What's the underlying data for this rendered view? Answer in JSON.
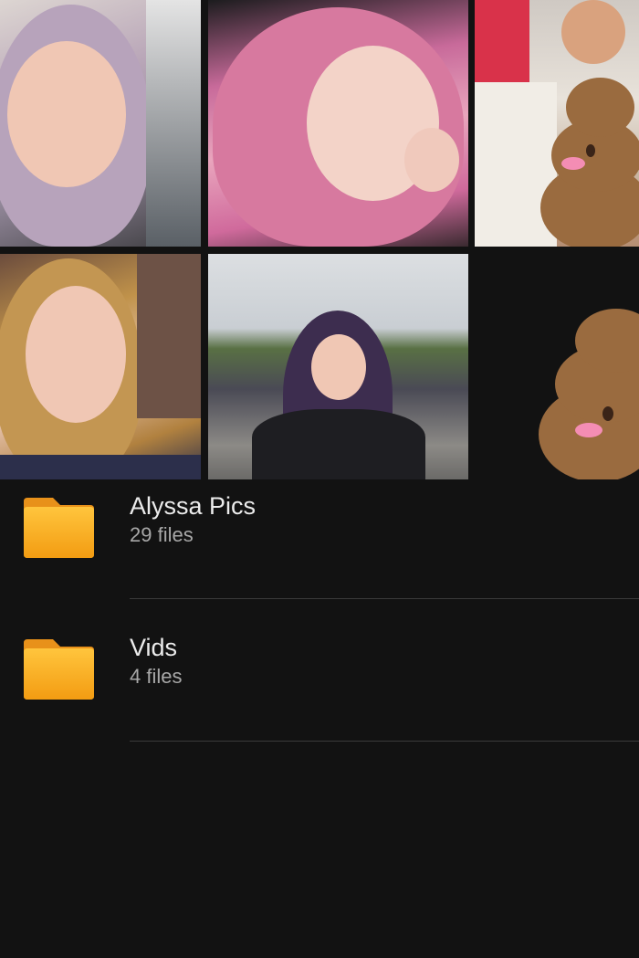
{
  "photos": [
    {
      "name": "photo-1"
    },
    {
      "name": "photo-2"
    },
    {
      "name": "photo-3"
    },
    {
      "name": "photo-4"
    },
    {
      "name": "photo-5"
    },
    {
      "name": "photo-6"
    }
  ],
  "folders": [
    {
      "name": "Alyssa Pics",
      "count": "29 files",
      "icon": "folder-icon",
      "color": "#f5a623"
    },
    {
      "name": "Vids",
      "count": "4 files",
      "icon": "folder-icon",
      "color": "#f5a623"
    }
  ],
  "theme": {
    "background": "#121212",
    "text": "#ececec",
    "subtext": "#a8a8a8"
  }
}
